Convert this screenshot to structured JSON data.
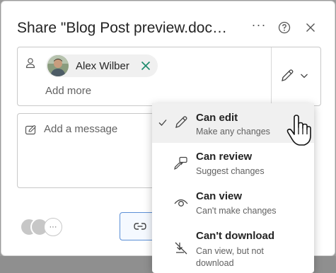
{
  "dialog": {
    "title": "Share \"Blog Post preview.doc…",
    "more_label": "···"
  },
  "recipients": {
    "chips": [
      {
        "name": "Alex Wilber"
      }
    ],
    "add_more_placeholder": "Add more"
  },
  "message": {
    "placeholder": "Add a message"
  },
  "permission_menu": {
    "items": [
      {
        "title": "Can edit",
        "description": "Make any changes",
        "selected": true,
        "icon": "pencil-icon"
      },
      {
        "title": "Can review",
        "description": "Suggest changes",
        "selected": false,
        "icon": "review-icon"
      },
      {
        "title": "Can view",
        "description": "Can't make changes",
        "selected": false,
        "icon": "eye-icon"
      },
      {
        "title": "Can't download",
        "description_line1": "Can view, but not",
        "description_line2": "download",
        "selected": false,
        "icon": "no-download-icon"
      }
    ]
  },
  "footer": {
    "more_label": "···"
  },
  "colors": {
    "accent": "#0f6cbd",
    "remove_x": "#1b8a6b",
    "backdrop": "#9a9a9a"
  }
}
